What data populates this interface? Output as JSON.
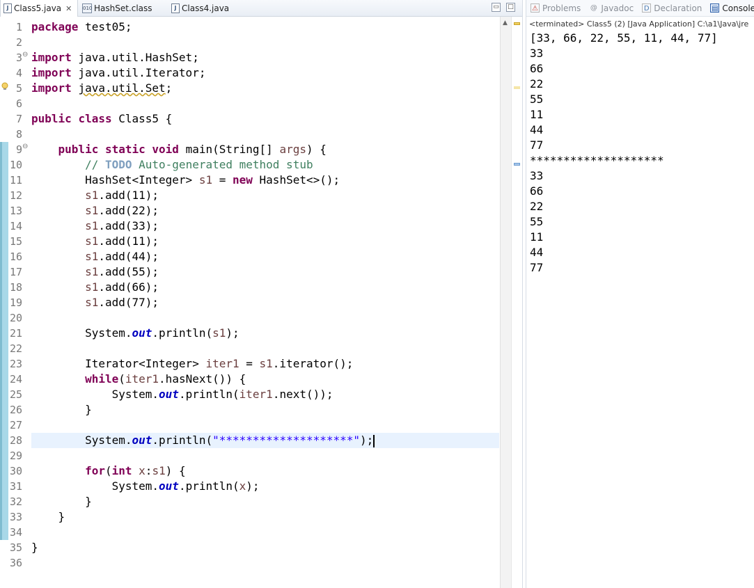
{
  "editor_tabs": [
    {
      "label": "Class5.java",
      "icon": "java-file-icon",
      "active": true,
      "close": "✕"
    },
    {
      "label": "HashSet.class",
      "icon": "class-file-icon",
      "active": false
    },
    {
      "label": "Class4.java",
      "icon": "java-file-icon",
      "active": false
    }
  ],
  "window_controls": {
    "minimize": "▭",
    "maximize": "□"
  },
  "line_numbers": [
    "1",
    "2",
    "3",
    "4",
    "5",
    "6",
    "7",
    "8",
    "9",
    "10",
    "11",
    "12",
    "13",
    "14",
    "15",
    "16",
    "17",
    "18",
    "19",
    "20",
    "21",
    "22",
    "23",
    "24",
    "25",
    "26",
    "27",
    "28",
    "29",
    "30",
    "31",
    "32",
    "33",
    "34",
    "35",
    "36"
  ],
  "code": {
    "l1_kw": "package",
    "l1_rest": " test05;",
    "l3_kw": "import",
    "l3_rest": " java.util.HashSet;",
    "l4_kw": "import",
    "l4_rest": " java.util.Iterator;",
    "l5_kw": "import",
    "l5_rest_a": " ",
    "l5_rest_b": "java.util.Set",
    "l5_rest_c": ";",
    "l7_kw1": "public",
    "l7_kw2": "class",
    "l7_rest": " Class5 {",
    "l9_indent": "    ",
    "l9_kw1": "public",
    "l9_kw2": "static",
    "l9_kw3": "void",
    "l9_rest": " main(String[] ",
    "l9_var": "args",
    "l9_end": ") {",
    "l10_indent": "        ",
    "l10_cm1": "// ",
    "l10_todo": "TODO",
    "l10_cm2": " Auto-generated method stub",
    "l11_a": "        HashSet<Integer> ",
    "l11_var": "s1",
    "l11_b": " = ",
    "l11_kw": "new",
    "l11_c": " HashSet<>();",
    "add_lines": [
      "11",
      "22",
      "33",
      "11",
      "44",
      "55",
      "66",
      "77"
    ],
    "s1": "s1",
    "add_call_open": ".add(",
    "add_call_close": ");",
    "l21_a": "        System.",
    "out": "out",
    "l21_b": ".println(",
    "l21_var": "s1",
    "l21_c": ");",
    "l23_a": "        Iterator<Integer> ",
    "l23_var": "iter1",
    "l23_b": " = ",
    "l23_var2": "s1",
    "l23_c": ".iterator();",
    "l24_indent": "        ",
    "l24_kw": "while",
    "l24_a": "(",
    "l24_var": "iter1",
    "l24_b": ".hasNext()) {",
    "l25_a": "            System.",
    "l25_b": ".println(",
    "l25_var": "iter1",
    "l25_c": ".next());",
    "l26": "        }",
    "l28_a": "        System.",
    "l28_b": ".println(",
    "l28_str": "\"********************\"",
    "l28_c": ");",
    "l30_indent": "        ",
    "l30_kw1": "for",
    "l30_a": "(",
    "l30_kw2": "int",
    "l30_b": " ",
    "l30_var": "x",
    "l30_c": ":",
    "l30_var2": "s1",
    "l30_d": ") {",
    "l31_a": "            System.",
    "l31_b": ".println(",
    "l31_var": "x",
    "l31_c": ");",
    "l32": "        }",
    "l33": "    }",
    "l35": "}"
  },
  "panel_tabs": [
    {
      "label": "Problems",
      "icon": "problems-icon",
      "glyph": "⚠",
      "active": false
    },
    {
      "label": "Javadoc",
      "icon": "javadoc-icon",
      "glyph": "@",
      "active": false
    },
    {
      "label": "Declaration",
      "icon": "declaration-icon",
      "glyph": "D",
      "active": false
    },
    {
      "label": "Console",
      "icon": "console-icon",
      "glyph": "▤",
      "active": true
    }
  ],
  "console": {
    "status": "<terminated> Class5 (2) [Java Application] C:\\a1\\Java\\jre",
    "output": [
      "[33, 66, 22, 55, 11, 44, 77]",
      "33",
      "66",
      "22",
      "55",
      "11",
      "44",
      "77",
      "********************",
      "33",
      "66",
      "22",
      "55",
      "11",
      "44",
      "77"
    ]
  },
  "colors": {
    "keyword": "#7f0055",
    "comment": "#3f7f5f",
    "string": "#2a00ff",
    "field": "#0000c0",
    "local_var": "#6a3e3e",
    "current_line": "#e8f2fe"
  }
}
